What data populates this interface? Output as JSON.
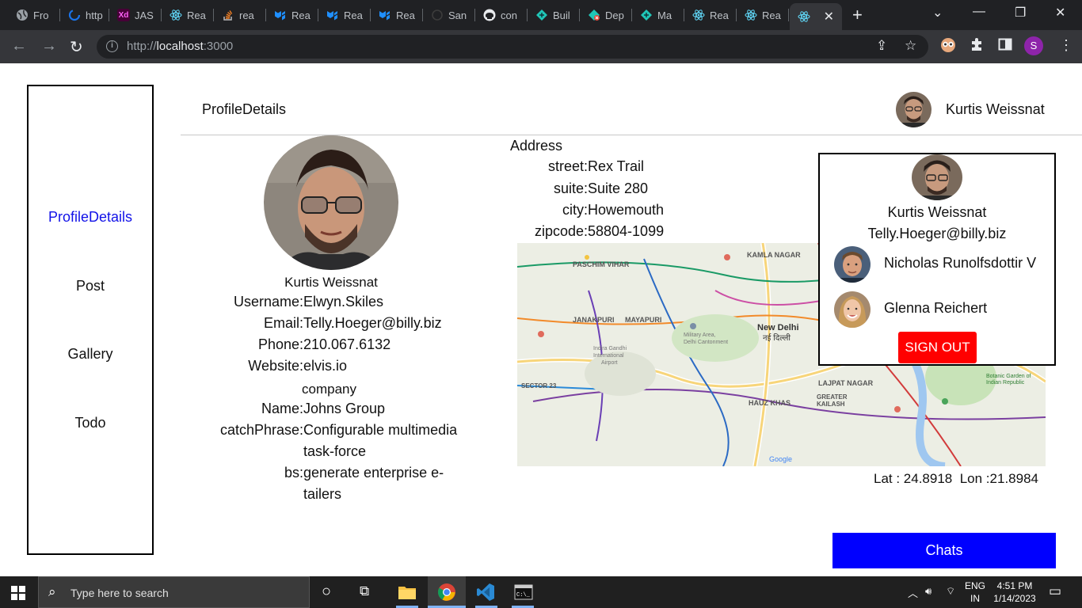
{
  "browser": {
    "tabs": [
      {
        "label": "Fro",
        "icon": "globe-icon"
      },
      {
        "label": "http",
        "icon": "spinner-icon"
      },
      {
        "label": "JAS",
        "icon": "xd-icon"
      },
      {
        "label": "Rea",
        "icon": "react-icon"
      },
      {
        "label": "rea",
        "icon": "stackoverflow-icon"
      },
      {
        "label": "Rea",
        "icon": "mui-icon"
      },
      {
        "label": "Rea",
        "icon": "mui-icon"
      },
      {
        "label": "Rea",
        "icon": "mui-icon"
      },
      {
        "label": "San",
        "icon": "codesandbox-icon"
      },
      {
        "label": "con",
        "icon": "github-icon"
      },
      {
        "label": "Buil",
        "icon": "netlify-icon"
      },
      {
        "label": "Dep",
        "icon": "netlify-error-icon"
      },
      {
        "label": "Ma",
        "icon": "netlify-icon"
      },
      {
        "label": "Rea",
        "icon": "react-icon"
      },
      {
        "label": "Rea",
        "icon": "react-icon"
      }
    ],
    "active_tab_icon": "react-icon",
    "url_prefix": "http://",
    "url_host": "localhost",
    "url_port": ":3000",
    "profile_initial": "S"
  },
  "header": {
    "title": "ProfileDetails",
    "user_name": "Kurtis Weissnat"
  },
  "sidebar": {
    "items": [
      {
        "label": "ProfileDetails",
        "active": true
      },
      {
        "label": "Post",
        "active": false
      },
      {
        "label": "Gallery",
        "active": false
      },
      {
        "label": "Todo",
        "active": false
      }
    ]
  },
  "profile": {
    "name": "Kurtis Weissnat",
    "fields": [
      {
        "key": "Username:",
        "value": "Elwyn.Skiles"
      },
      {
        "key": "Email:",
        "value": "Telly.Hoeger@billy.biz"
      },
      {
        "key": "Phone:",
        "value": "210.067.6132"
      },
      {
        "key": "Website:",
        "value": "elvis.io"
      }
    ],
    "company_heading": "company",
    "company_fields": [
      {
        "key": "Name:",
        "value": "Johns Group"
      },
      {
        "key": "catchPhrase:",
        "value_lines": [
          "Configurable multimedia",
          "task-force"
        ]
      },
      {
        "key": "bs:",
        "value_lines": [
          "generate enterprise e-",
          "tailers"
        ]
      }
    ]
  },
  "address": {
    "heading": "Address",
    "fields": [
      {
        "key": "street:",
        "value": "Rex Trail"
      },
      {
        "key": "suite:",
        "value": "Suite 280"
      },
      {
        "key": "city:",
        "value": "Howemouth"
      },
      {
        "key": "zipcode:",
        "value": "58804-1099"
      }
    ],
    "lat_label": "Lat : 24.8918",
    "lon_label": "Lon :21.8984"
  },
  "map": {
    "labels": [
      "PASCHIM VIHAR",
      "KAMLA NAGAR",
      "JANAKPURI",
      "MAYAPURI",
      "New Delhi",
      "नई दिल्ली",
      "Indira Gandhi International Airport",
      "Military Area, Delhi Cantonment",
      "LAJPAT NAGAR",
      "HAUZ KHAS",
      "GREATER KAILASH",
      "SECTOR 23",
      "Botanic Garden of Indian Republic",
      "Google"
    ]
  },
  "card": {
    "name": "Kurtis Weissnat",
    "email": "Telly.Hoeger@billy.biz",
    "friends": [
      {
        "name": "Nicholas Runolfsdottir V"
      },
      {
        "name": "Glenna Reichert"
      }
    ],
    "signout_label": "SIGN OUT"
  },
  "chats_label": "Chats",
  "taskbar": {
    "search_placeholder": "Type here to search",
    "lang_line1": "ENG",
    "lang_line2": "IN",
    "time": "4:51 PM",
    "date": "1/14/2023"
  },
  "colors": {
    "active_link": "#1212e8",
    "signout_bg": "#ff0000",
    "chats_bg": "#0000ff"
  }
}
